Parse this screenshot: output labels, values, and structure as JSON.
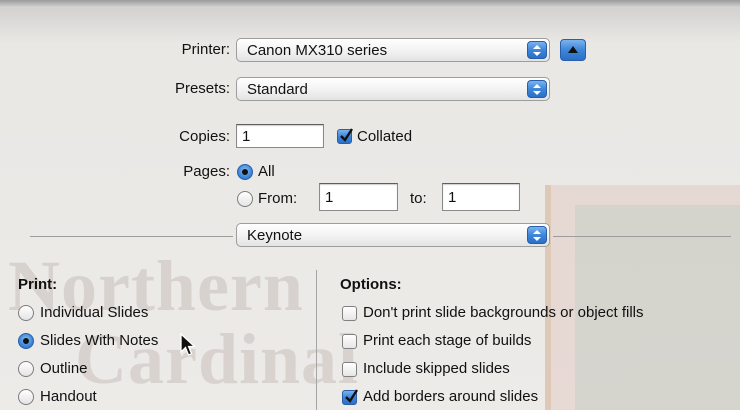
{
  "printer": {
    "label": "Printer:",
    "value": "Canon MX310 series"
  },
  "presets": {
    "label": "Presets:",
    "value": "Standard"
  },
  "copies": {
    "label": "Copies:",
    "value": "1",
    "collated_label": "Collated",
    "collated_checked": true
  },
  "pages": {
    "label": "Pages:",
    "all_label": "All",
    "from_label": "From:",
    "from_value": "1",
    "to_label": "to:",
    "to_value": "1",
    "selected": "All"
  },
  "panel": {
    "value": "Keynote"
  },
  "print_section": {
    "heading": "Print:",
    "options": [
      {
        "label": "Individual Slides",
        "selected": false
      },
      {
        "label": "Slides With Notes",
        "selected": true
      },
      {
        "label": "Outline",
        "selected": false
      },
      {
        "label": "Handout",
        "selected": false
      }
    ]
  },
  "options_section": {
    "heading": "Options:",
    "items": [
      {
        "label": "Don't print slide backgrounds or object fills",
        "checked": false
      },
      {
        "label": "Print each stage of builds",
        "checked": false
      },
      {
        "label": "Include skipped slides",
        "checked": false
      },
      {
        "label": "Add borders around slides",
        "checked": true
      }
    ]
  },
  "colors": {
    "accent": "#3d86d9",
    "background": "#ecebe8"
  }
}
